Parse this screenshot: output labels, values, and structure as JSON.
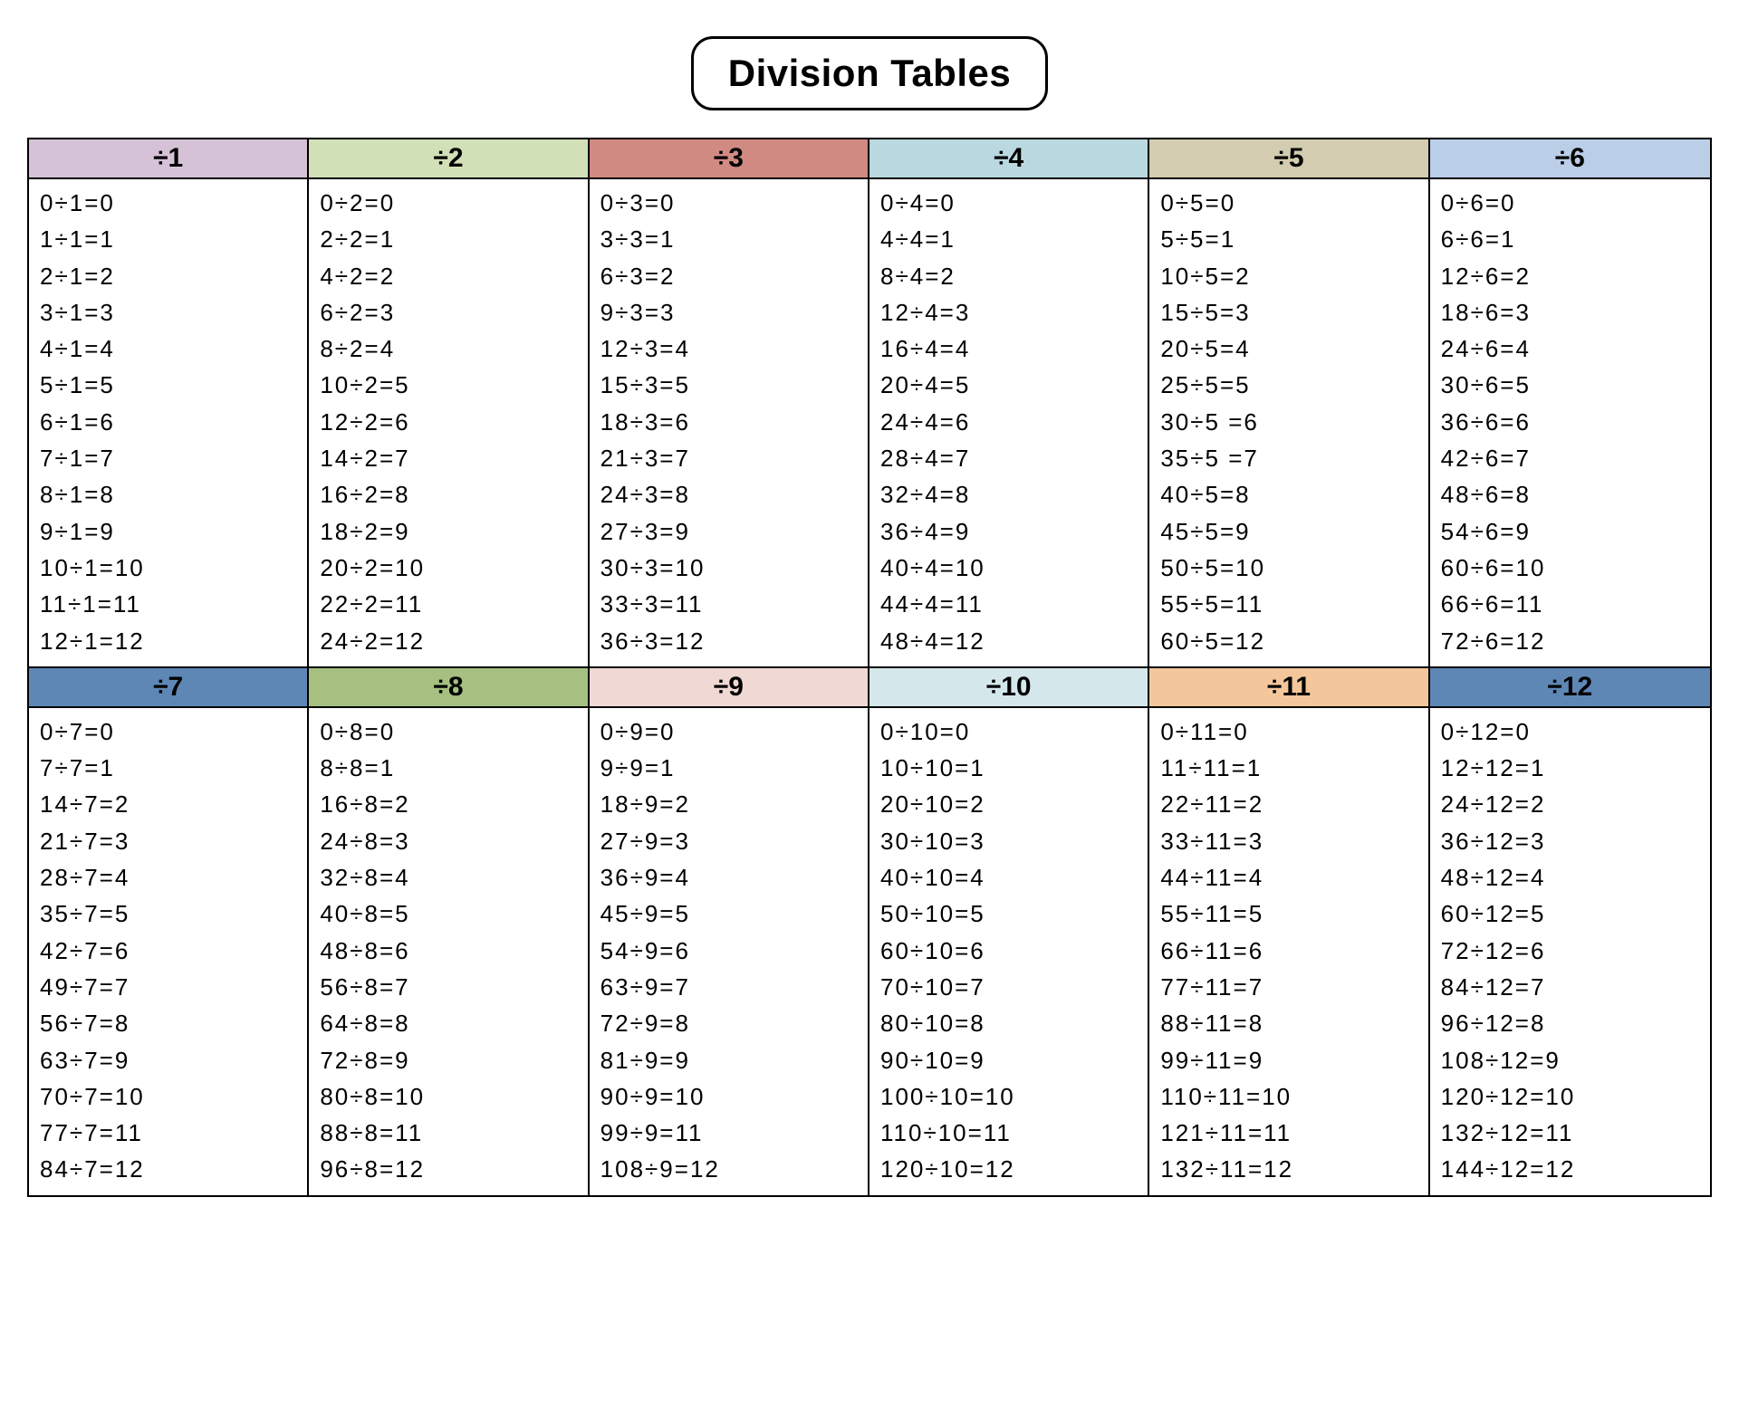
{
  "title": "Division Tables",
  "headers": [
    "÷1",
    "÷2",
    "÷3",
    "÷4",
    "÷5",
    "÷6",
    "÷7",
    "÷8",
    "÷9",
    "÷10",
    "÷11",
    "÷12"
  ],
  "tables": {
    "t1": [
      "0÷1=0",
      "1÷1=1",
      "2÷1=2",
      "3÷1=3",
      "4÷1=4",
      "5÷1=5",
      "6÷1=6",
      "7÷1=7",
      "8÷1=8",
      "9÷1=9",
      "10÷1=10",
      "11÷1=11",
      "12÷1=12"
    ],
    "t2": [
      "0÷2=0",
      "2÷2=1",
      "4÷2=2",
      "6÷2=3",
      "8÷2=4",
      "10÷2=5",
      "12÷2=6",
      "14÷2=7",
      "16÷2=8",
      "18÷2=9",
      "20÷2=10",
      "22÷2=11",
      "24÷2=12"
    ],
    "t3": [
      "0÷3=0",
      "3÷3=1",
      "6÷3=2",
      "9÷3=3",
      "12÷3=4",
      "15÷3=5",
      "18÷3=6",
      "21÷3=7",
      "24÷3=8",
      "27÷3=9",
      "30÷3=10",
      "33÷3=11",
      "36÷3=12"
    ],
    "t4": [
      "0÷4=0",
      "4÷4=1",
      "8÷4=2",
      "12÷4=3",
      "16÷4=4",
      "20÷4=5",
      "24÷4=6",
      "28÷4=7",
      "32÷4=8",
      "36÷4=9",
      "40÷4=10",
      "44÷4=11",
      "48÷4=12"
    ],
    "t5": [
      "0÷5=0",
      "5÷5=1",
      "10÷5=2",
      "15÷5=3",
      "20÷5=4",
      "25÷5=5",
      "30÷5 =6",
      "35÷5 =7",
      "40÷5=8",
      "45÷5=9",
      "50÷5=10",
      "55÷5=11",
      "60÷5=12"
    ],
    "t6": [
      "0÷6=0",
      "6÷6=1",
      "12÷6=2",
      "18÷6=3",
      "24÷6=4",
      "30÷6=5",
      "36÷6=6",
      "42÷6=7",
      "48÷6=8",
      "54÷6=9",
      "60÷6=10",
      "66÷6=11",
      "72÷6=12"
    ],
    "t7": [
      "0÷7=0",
      "7÷7=1",
      "14÷7=2",
      "21÷7=3",
      "28÷7=4",
      "35÷7=5",
      "42÷7=6",
      "49÷7=7",
      "56÷7=8",
      "63÷7=9",
      "70÷7=10",
      "77÷7=11",
      "84÷7=12"
    ],
    "t8": [
      "0÷8=0",
      "8÷8=1",
      "16÷8=2",
      "24÷8=3",
      "32÷8=4",
      "40÷8=5",
      "48÷8=6",
      "56÷8=7",
      "64÷8=8",
      "72÷8=9",
      "80÷8=10",
      "88÷8=11",
      "96÷8=12"
    ],
    "t9": [
      "0÷9=0",
      "9÷9=1",
      "18÷9=2",
      "27÷9=3",
      "36÷9=4",
      "45÷9=5",
      "54÷9=6",
      "63÷9=7",
      "72÷9=8",
      "81÷9=9",
      "90÷9=10",
      "99÷9=11",
      "108÷9=12"
    ],
    "t10": [
      "0÷10=0",
      "10÷10=1",
      "20÷10=2",
      "30÷10=3",
      "40÷10=4",
      "50÷10=5",
      "60÷10=6",
      "70÷10=7",
      "80÷10=8",
      "90÷10=9",
      "100÷10=10",
      "110÷10=11",
      "120÷10=12"
    ],
    "t11": [
      "0÷11=0",
      "11÷11=1",
      "22÷11=2",
      "33÷11=3",
      "44÷11=4",
      "55÷11=5",
      "66÷11=6",
      "77÷11=7",
      "88÷11=8",
      "99÷11=9",
      "110÷11=10",
      "121÷11=11",
      "132÷11=12"
    ],
    "t12": [
      "0÷12=0",
      "12÷12=1",
      "24÷12=2",
      "36÷12=3",
      "48÷12=4",
      "60÷12=5",
      "72÷12=6",
      "84÷12=7",
      "96÷12=8",
      "108÷12=9",
      "120÷12=10",
      "132÷12=11",
      "144÷12=12"
    ]
  }
}
